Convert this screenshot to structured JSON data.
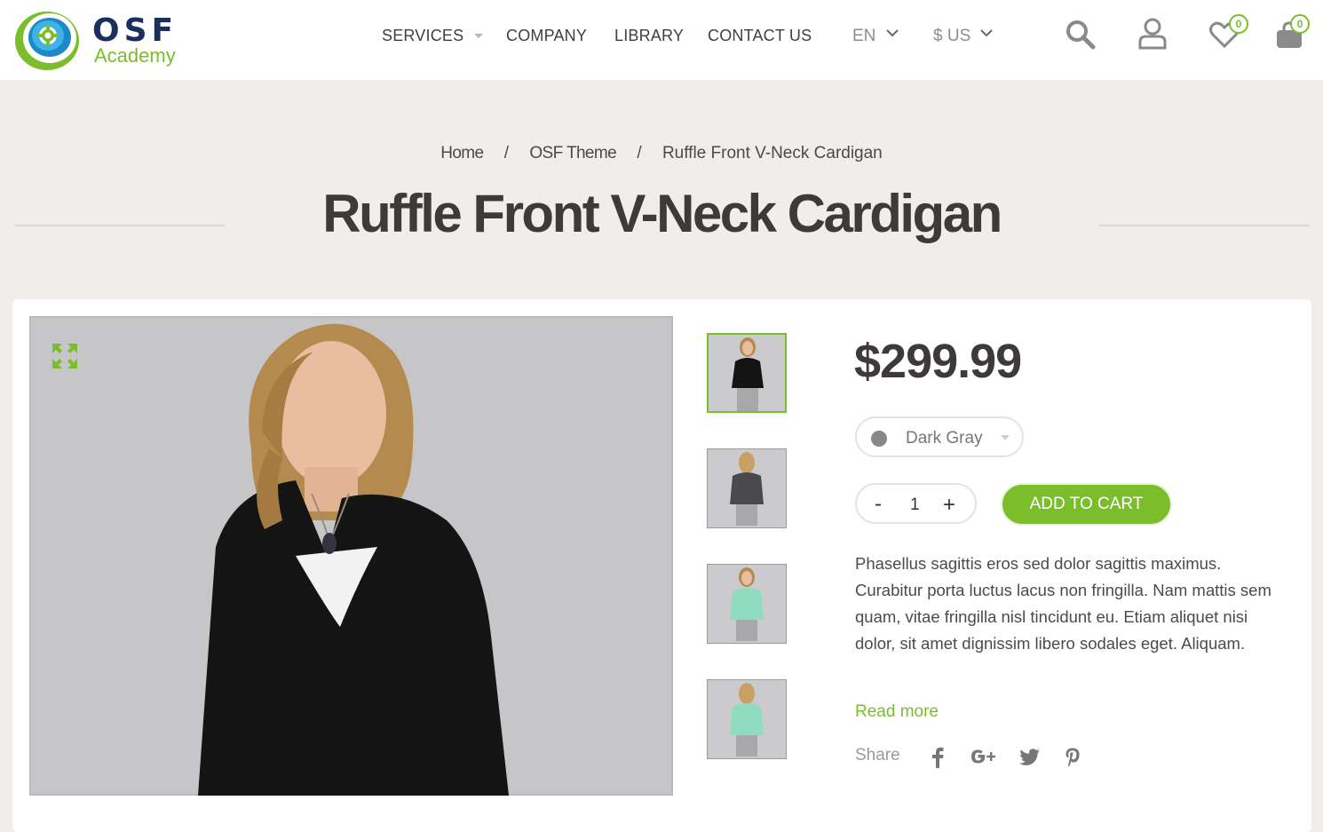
{
  "brand": {
    "name": "OSF",
    "tagline": "Academy",
    "accent": "#7bbd2b",
    "dark": "#1b2f5c"
  },
  "nav": {
    "items": [
      {
        "label": "SERVICES",
        "has_dropdown": true
      },
      {
        "label": "COMPANY"
      },
      {
        "label": "LIBRARY"
      },
      {
        "label": "CONTACT US"
      }
    ],
    "language": "EN",
    "currency": "$ US"
  },
  "header_icons": {
    "search": "search-icon",
    "account": "user-icon",
    "wishlist": {
      "icon": "heart-icon",
      "count": "0"
    },
    "cart": {
      "icon": "cart-icon",
      "count": "0"
    }
  },
  "breadcrumb": {
    "items": [
      "Home",
      "OSF Theme",
      "Ruffle Front V-Neck Cardigan"
    ],
    "separator": "/"
  },
  "product": {
    "title": "Ruffle Front V-Neck Cardigan",
    "price": "$299.99",
    "color": {
      "selected": "Dark Gray",
      "swatch": "#888888"
    },
    "quantity": {
      "minus": "-",
      "value": "1",
      "plus": "+"
    },
    "add_to_cart": "ADD TO CART",
    "description": "Phasellus sagittis eros sed dolor sagittis maximus. Curabitur porta luctus lacus non fringilla. Nam mattis sem quam, vitae fringilla nisl tincidunt eu. Etiam aliquet nisi dolor, sit amet dignissim libero sodales eget. Aliquam.",
    "read_more": "Read more",
    "share_label": "Share",
    "share_icons": [
      "facebook-icon",
      "google-plus-icon",
      "twitter-icon",
      "pinterest-icon"
    ],
    "thumbnails": [
      {
        "variant": "black front",
        "active": true
      },
      {
        "variant": "gray back",
        "active": false
      },
      {
        "variant": "mint front",
        "active": false
      },
      {
        "variant": "mint back",
        "active": false
      }
    ]
  }
}
